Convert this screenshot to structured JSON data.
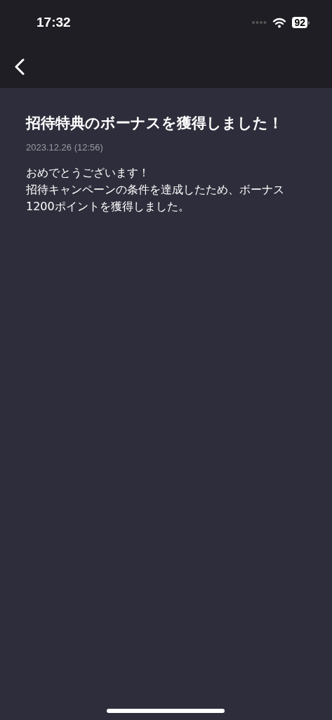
{
  "status_bar": {
    "time": "17:32",
    "battery": "92"
  },
  "article": {
    "title": "招待特典のボーナスを獲得しました！",
    "date": "2023.12.26 (12:56)",
    "paragraphs": [
      "おめでとうございます！",
      "招待キャンペーンの条件を達成したため、ボーナス1200ポイントを獲得しました。"
    ]
  }
}
